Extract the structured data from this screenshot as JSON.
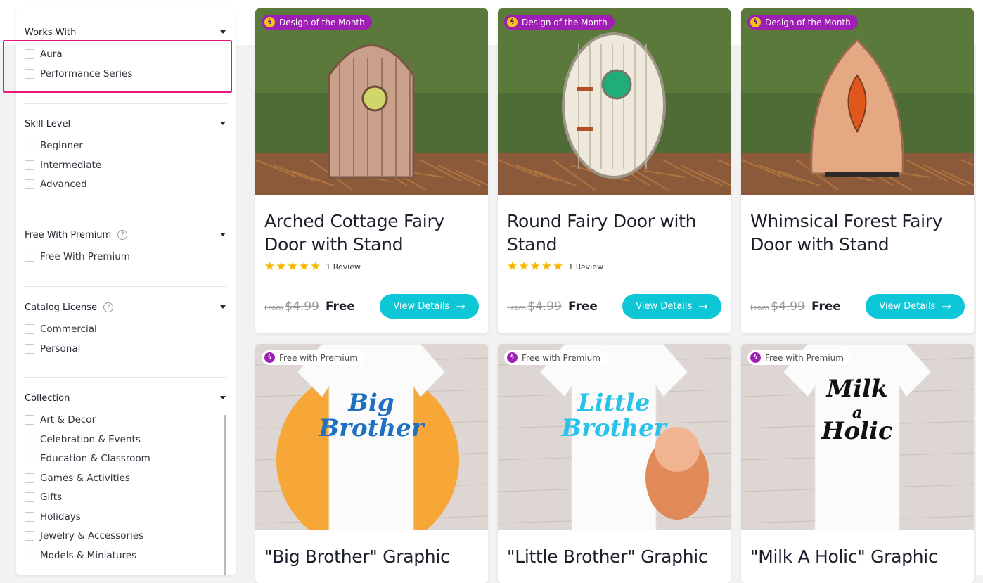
{
  "filters": [
    {
      "title": "Works With",
      "help": false,
      "options": [
        "Aura",
        "Performance Series"
      ]
    },
    {
      "title": "Skill Level",
      "help": false,
      "options": [
        "Beginner",
        "Intermediate",
        "Advanced"
      ]
    },
    {
      "title": "Free With Premium",
      "help": true,
      "options": [
        "Free With Premium"
      ]
    },
    {
      "title": "Catalog License",
      "help": true,
      "options": [
        "Commercial",
        "Personal"
      ]
    },
    {
      "title": "Collection",
      "help": false,
      "options": [
        "Art & Decor",
        "Celebration & Events",
        "Education & Classroom",
        "Games & Activities",
        "Gifts",
        "Holidays",
        "Jewelry & Accessories",
        "Models & Miniatures"
      ]
    }
  ],
  "help_glyph": "?",
  "cards": [
    {
      "badge": "Design of the Month",
      "badge_type": "dom",
      "title": "Arched Cottage Fairy Door with Stand",
      "rating": 5,
      "reviews": "1 Review",
      "from": "From",
      "old_price": "$4.99",
      "price": "Free",
      "button": "View Details"
    },
    {
      "badge": "Design of the Month",
      "badge_type": "dom",
      "title": "Round Fairy Door with Stand",
      "rating": 5,
      "reviews": "1 Review",
      "from": "From",
      "old_price": "$4.99",
      "price": "Free",
      "button": "View Details"
    },
    {
      "badge": "Design of the Month",
      "badge_type": "dom",
      "title": "Whimsical Forest Fairy Door with Stand",
      "rating": 0,
      "reviews": "",
      "from": "From",
      "old_price": "$4.99",
      "price": "Free",
      "button": "View Details"
    },
    {
      "badge": "Free with Premium",
      "badge_type": "fwp",
      "title": "\"Big Brother\" Graphic",
      "graphic_text": [
        "Big",
        "Brother"
      ],
      "graphic_color": "#1f6fc2"
    },
    {
      "badge": "Free with Premium",
      "badge_type": "fwp",
      "title": "\"Little Brother\" Graphic",
      "graphic_text": [
        "Little",
        "Brother"
      ],
      "graphic_color": "#27c3e8"
    },
    {
      "badge": "Free with Premium",
      "badge_type": "fwp",
      "title": "\"Milk A Holic\" Graphic",
      "graphic_text": [
        "Milk",
        "a",
        "Holic"
      ],
      "graphic_color": "#111111"
    }
  ],
  "colors": {
    "accent": "#0dc6d6",
    "badge_purple": "#9d1fb3",
    "highlight": "#e8177d",
    "star": "#f5b800"
  }
}
